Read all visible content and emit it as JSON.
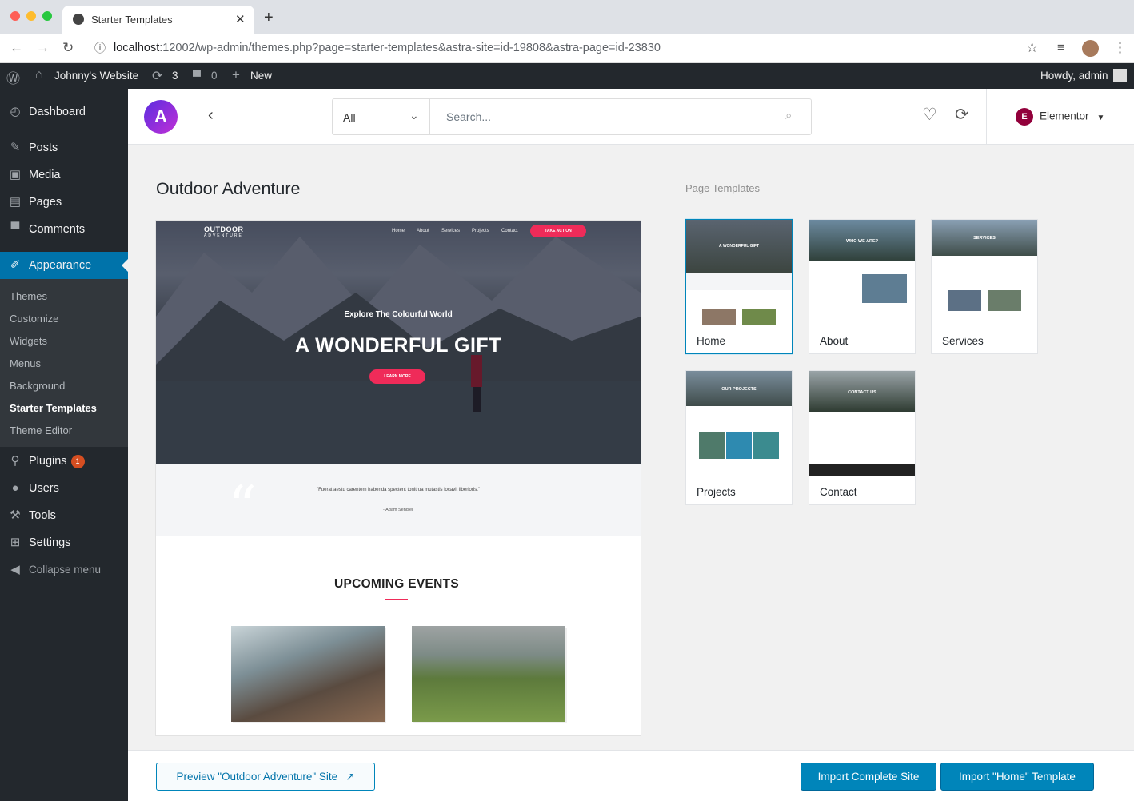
{
  "browser": {
    "tab_title": "Starter Templates",
    "url_host": "localhost",
    "url_rest": ":12002/wp-admin/themes.php?page=starter-templates&astra-site=id-19808&astra-page=id-23830"
  },
  "adminbar": {
    "site_name": "Johnny's Website",
    "updates_count": "3",
    "comments_count": "0",
    "new_label": "New",
    "greeting": "Howdy, admin"
  },
  "sidebar": {
    "items": [
      {
        "label": "Dashboard"
      },
      {
        "label": "Posts"
      },
      {
        "label": "Media"
      },
      {
        "label": "Pages"
      },
      {
        "label": "Comments"
      },
      {
        "label": "Appearance"
      },
      {
        "label": "Plugins"
      },
      {
        "label": "Users"
      },
      {
        "label": "Tools"
      },
      {
        "label": "Settings"
      },
      {
        "label": "Collapse menu"
      }
    ],
    "plugins_badge": "1",
    "submenu": [
      "Themes",
      "Customize",
      "Widgets",
      "Menus",
      "Background",
      "Starter Templates",
      "Theme Editor"
    ]
  },
  "header": {
    "filter_value": "All",
    "search_placeholder": "Search...",
    "page_builder": "Elementor"
  },
  "main": {
    "site_title": "Outdoor Adventure",
    "page_templates_label": "Page Templates",
    "preview": {
      "logo_line1": "OUTDOOR",
      "logo_line2": "ADVENTURE",
      "nav": [
        "Home",
        "About",
        "Services",
        "Projects",
        "Contact"
      ],
      "cta": "TAKE ACTION",
      "subtitle": "Explore The Colourful World",
      "title": "A WONDERFUL GIFT",
      "button": "LEARN MORE",
      "quote": "\"Fuerat aestu carentem habenda spectent tonitrua mutastis locavit liberioris.\"",
      "quote_author": "- Adam Sendler",
      "events_title": "UPCOMING EVENTS"
    },
    "templates": [
      {
        "label": "Home",
        "hero": "A WONDERFUL GIFT"
      },
      {
        "label": "About",
        "hero": "WHO WE ARE?"
      },
      {
        "label": "Services",
        "hero": "SERVICES"
      },
      {
        "label": "Projects",
        "hero": "OUR PROJECTS"
      },
      {
        "label": "Contact",
        "hero": "CONTACT US"
      }
    ]
  },
  "footer": {
    "preview_button": "Preview \"Outdoor Adventure\" Site",
    "import_site_button": "Import Complete Site",
    "import_template_button": "Import \"Home\" Template"
  },
  "colors": {
    "wp_admin_dark": "#23282d",
    "accent_blue": "#0085ba",
    "template_pink": "#ef2b59"
  }
}
